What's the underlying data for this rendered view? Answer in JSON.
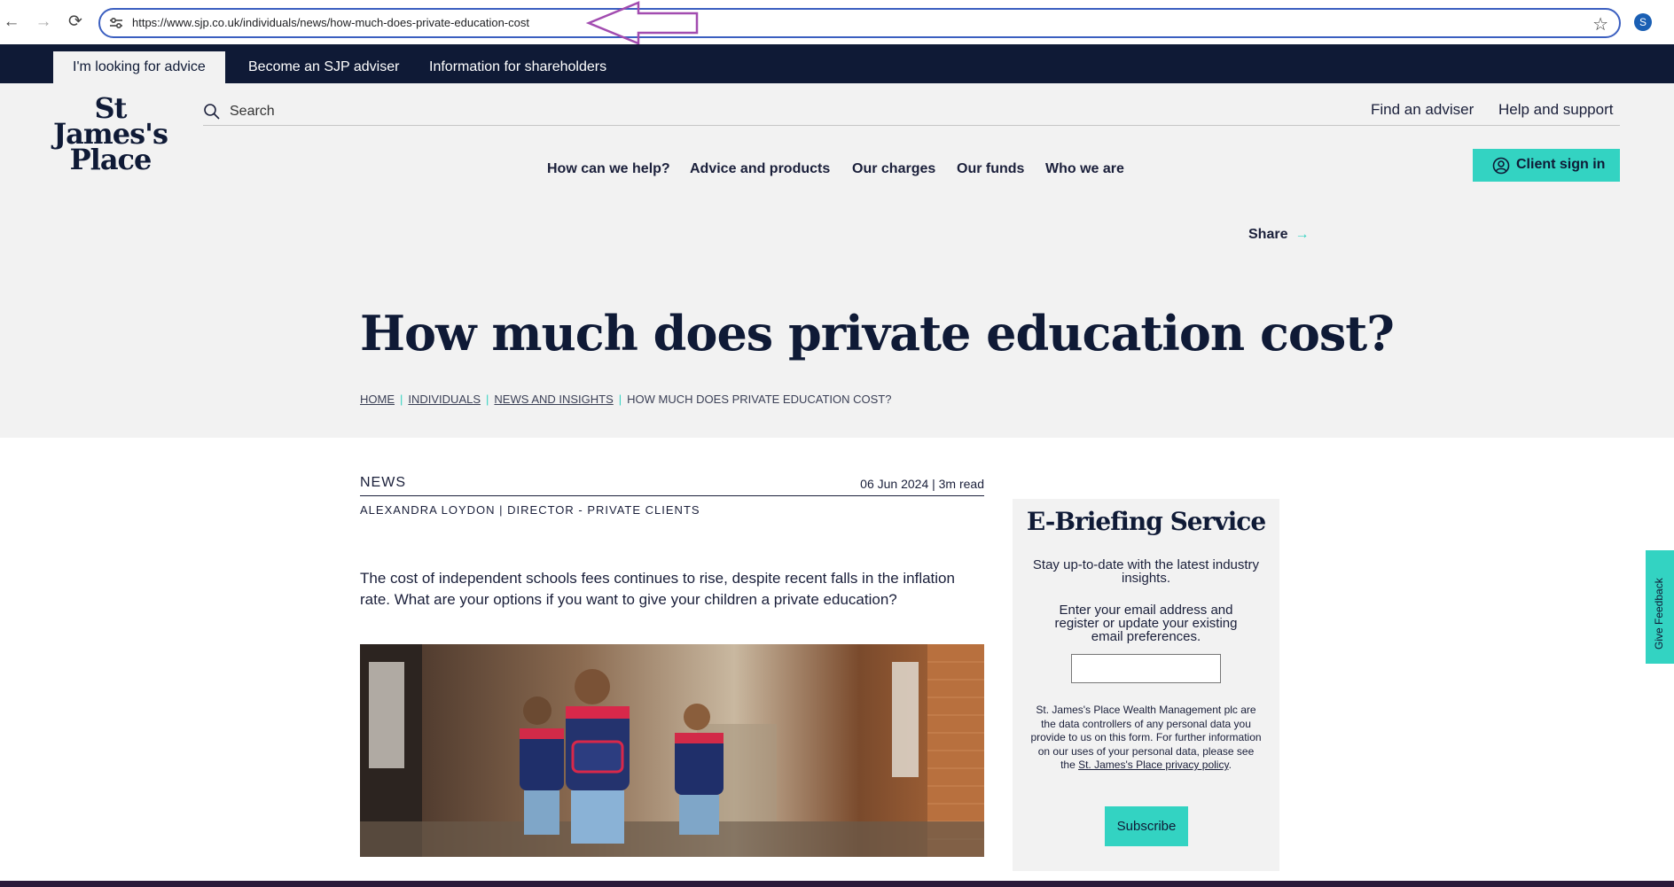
{
  "browser": {
    "url": "https://www.sjp.co.uk/individuals/news/how-much-does-private-education-cost",
    "profile_initial": "S"
  },
  "topbar": {
    "tabs": [
      "I'm looking for advice",
      "Become an SJP adviser",
      "Information for shareholders"
    ]
  },
  "logo": {
    "line1": "St",
    "line2": "James's",
    "line3": "Place"
  },
  "header": {
    "search_placeholder": "Search",
    "find_adviser": "Find an adviser",
    "help_support": "Help and support",
    "nav": [
      "How can we help?",
      "Advice and products",
      "Our charges",
      "Our funds",
      "Who we are"
    ],
    "client_signin": "Client sign in",
    "share": "Share",
    "share_arrow": "→"
  },
  "page": {
    "title": "How much does private education cost?",
    "breadcrumb": [
      "HOME",
      "INDIVIDUALS",
      "NEWS AND INSIGHTS",
      "HOW MUCH DOES PRIVATE EDUCATION COST?"
    ],
    "breadcrumb_sep": "|"
  },
  "article": {
    "kicker": "NEWS",
    "date_read": "06 Jun 2024 | 3m read",
    "author": "ALEXANDRA LOYDON | DIRECTOR - PRIVATE CLIENTS",
    "intro": "The cost of independent schools fees continues to rise, despite recent falls in the inflation rate. What are your options if you want to give your children a private education?"
  },
  "ebriefing": {
    "title": "E-Briefing Service",
    "p1": "Stay up-to-date with the latest industry insights.",
    "p2": "Enter your email address and register or update your existing email preferences.",
    "legal_prefix": "St. James's Place Wealth Management plc are the data controllers of any personal data you provide to us on this form. For further information on our uses of your personal data, please see the ",
    "legal_link": "St. James's Place privacy policy",
    "legal_suffix": ".",
    "subscribe": "Subscribe"
  },
  "feedback": "Give Feedback",
  "colors": {
    "navy": "#0f1a36",
    "teal": "#33d3c2",
    "panel": "#f2f2f2"
  }
}
